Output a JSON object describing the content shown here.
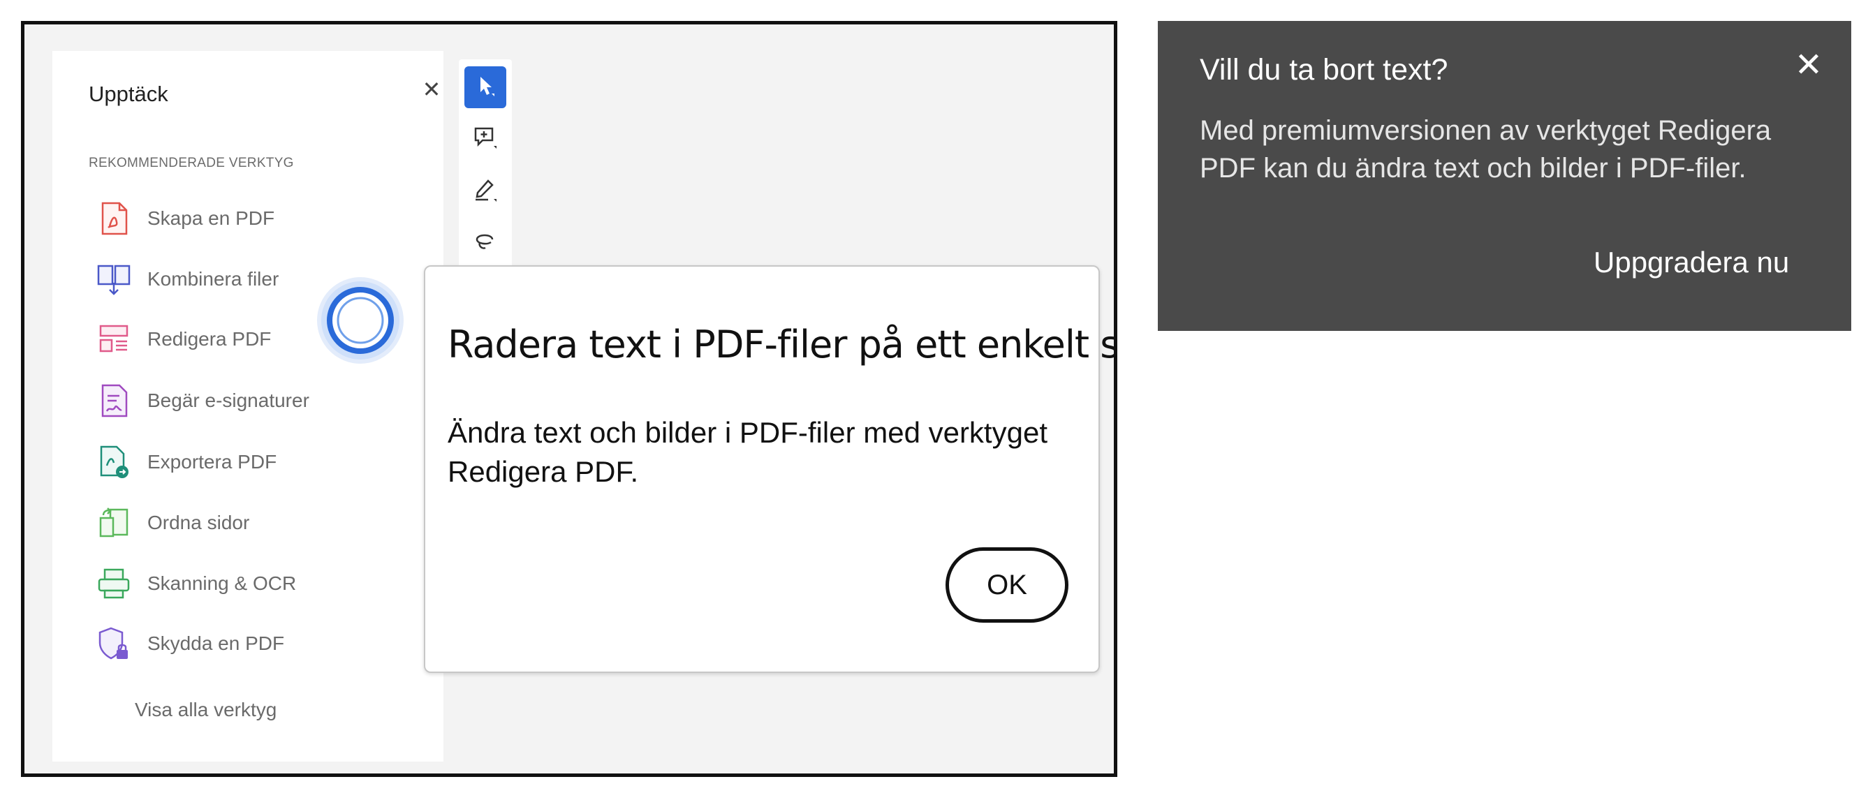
{
  "side_panel": {
    "title": "Upptäck",
    "close_icon": "close-icon",
    "section_label": "REKOMMENDERADE VERKTYG",
    "tools": [
      {
        "label": "Skapa en PDF",
        "icon": "create-pdf-icon",
        "color": "#e0524a"
      },
      {
        "label": "Kombinera filer",
        "icon": "combine-files-icon",
        "color": "#4a58c8"
      },
      {
        "label": "Redigera PDF",
        "icon": "edit-pdf-icon",
        "color": "#e05a8a"
      },
      {
        "label": "Begär e-signaturer",
        "icon": "request-signatures-icon",
        "color": "#a04ac0"
      },
      {
        "label": "Exportera PDF",
        "icon": "export-pdf-icon",
        "color": "#1f8f7a"
      },
      {
        "label": "Ordna sidor",
        "icon": "organize-pages-icon",
        "color": "#5bb85b"
      },
      {
        "label": "Skanning & OCR",
        "icon": "scan-ocr-icon",
        "color": "#3aa85c"
      },
      {
        "label": "Skydda en PDF",
        "icon": "protect-pdf-icon",
        "color": "#7a5ad0"
      }
    ],
    "show_all": "Visa alla verktyg"
  },
  "toolbar": {
    "tools": [
      "select-cursor-icon",
      "add-comment-icon",
      "draw-pen-icon",
      "lasso-icon"
    ],
    "active_color": "#2a6ad9"
  },
  "dialog": {
    "title": "Radera text i PDF-filer på ett enkelt sätt",
    "body": "Ändra text och bilder i PDF-filer med verktyget Redigera PDF.",
    "ok_label": "OK"
  },
  "tooltip": {
    "title": "Vill du ta bort text?",
    "body": "Med premiumversionen av verktyget Redigera PDF kan du ändra text och bilder i PDF-filer.",
    "link_label": "Uppgradera nu",
    "background": "#4a4a4a"
  }
}
